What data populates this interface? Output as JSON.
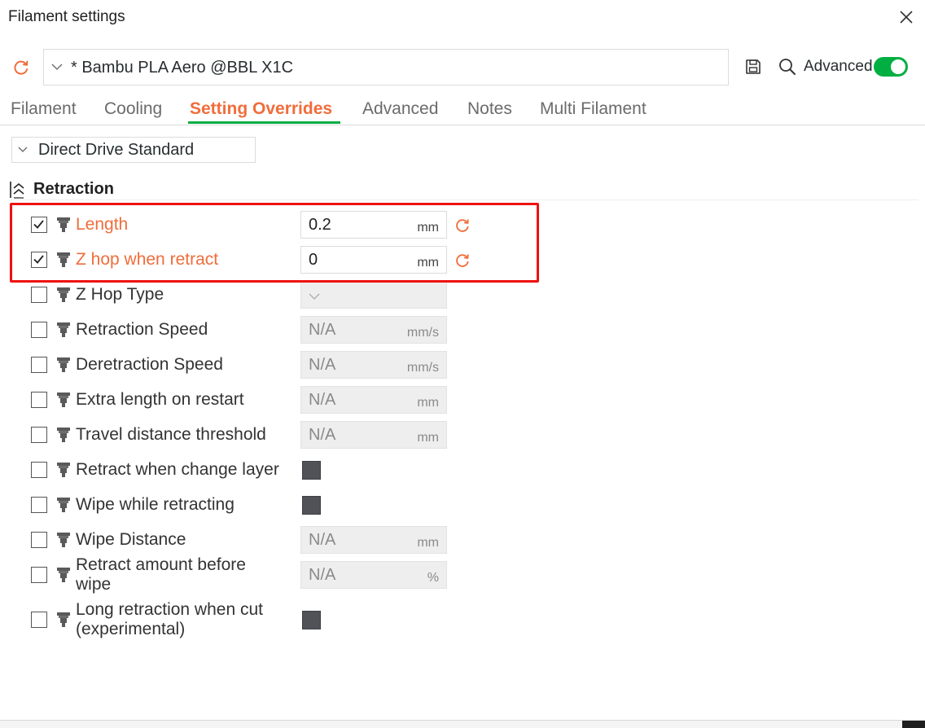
{
  "window": {
    "title": "Filament settings"
  },
  "preset": {
    "selected": "* Bambu PLA Aero @BBL X1C",
    "advanced_label": "Advanced",
    "advanced_on": true
  },
  "tabs": [
    {
      "label": "Filament",
      "active": false
    },
    {
      "label": "Cooling",
      "active": false
    },
    {
      "label": "Setting Overrides",
      "active": true
    },
    {
      "label": "Advanced",
      "active": false
    },
    {
      "label": "Notes",
      "active": false
    },
    {
      "label": "Multi Filament",
      "active": false
    }
  ],
  "extruder": {
    "selected": "Direct Drive Standard"
  },
  "section": {
    "title": "Retraction"
  },
  "options": [
    {
      "label": "Length",
      "checked": true,
      "modified": true,
      "type": "number",
      "value": "0.2",
      "unit": "mm"
    },
    {
      "label": "Z hop when retract",
      "checked": true,
      "modified": true,
      "type": "number",
      "value": "0",
      "unit": "mm"
    },
    {
      "label": "Z Hop Type",
      "checked": false,
      "modified": false,
      "type": "combo",
      "value": "",
      "unit": ""
    },
    {
      "label": "Retraction Speed",
      "checked": false,
      "modified": false,
      "type": "number",
      "value": "N/A",
      "unit": "mm/s"
    },
    {
      "label": "Deretraction Speed",
      "checked": false,
      "modified": false,
      "type": "number",
      "value": "N/A",
      "unit": "mm/s"
    },
    {
      "label": "Extra length on restart",
      "checked": false,
      "modified": false,
      "type": "number",
      "value": "N/A",
      "unit": "mm"
    },
    {
      "label": "Travel distance threshold",
      "checked": false,
      "modified": false,
      "type": "number",
      "value": "N/A",
      "unit": "mm"
    },
    {
      "label": "Retract when change layer",
      "checked": false,
      "modified": false,
      "type": "bool",
      "value": "",
      "unit": ""
    },
    {
      "label": "Wipe while retracting",
      "checked": false,
      "modified": false,
      "type": "bool",
      "value": "",
      "unit": ""
    },
    {
      "label": "Wipe Distance",
      "checked": false,
      "modified": false,
      "type": "number",
      "value": "N/A",
      "unit": "mm"
    },
    {
      "label_lines": [
        "Retract amount before",
        "wipe"
      ],
      "checked": false,
      "modified": false,
      "type": "number",
      "value": "N/A",
      "unit": "%"
    },
    {
      "label_lines": [
        "Long retraction when cut",
        "(experimental)"
      ],
      "checked": false,
      "modified": false,
      "type": "bool",
      "value": "",
      "unit": ""
    }
  ],
  "colors": {
    "accent_orange": "#f06d3b",
    "accent_green": "#00ae42",
    "highlight_red": "#ee1111"
  }
}
